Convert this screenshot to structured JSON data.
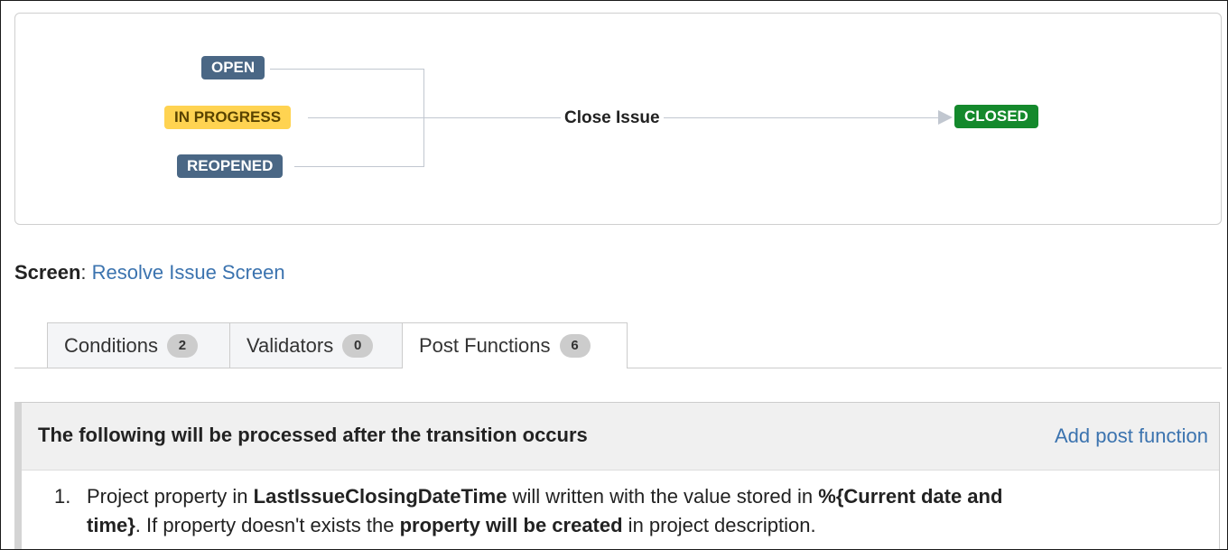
{
  "workflow": {
    "from_statuses": [
      {
        "label": "OPEN",
        "category": "to-do",
        "color": "#4a6785"
      },
      {
        "label": "IN PROGRESS",
        "category": "in-progress",
        "color": "#ffd351"
      },
      {
        "label": "REOPENED",
        "category": "to-do",
        "color": "#4a6785"
      }
    ],
    "transition": "Close Issue",
    "to_status": {
      "label": "CLOSED",
      "category": "done",
      "color": "#14892c"
    }
  },
  "screen": {
    "label": "Screen",
    "separator": ":",
    "value": "Resolve Issue Screen"
  },
  "tabs": [
    {
      "label": "Conditions",
      "count": "2",
      "active": false
    },
    {
      "label": "Validators",
      "count": "0",
      "active": false
    },
    {
      "label": "Post Functions",
      "count": "6",
      "active": true
    }
  ],
  "panel": {
    "title": "The following will be processed after the transition occurs",
    "action": "Add post function"
  },
  "post_functions": [
    {
      "number": "1.",
      "t1": "Project property in ",
      "b1": "LastIssueClosingDateTime",
      "t2": " will written with the value stored in ",
      "b2": "%{Current date and time}",
      "t3": ". If property doesn't exists the ",
      "b3": "property will be created",
      "t4": " in project description."
    }
  ]
}
